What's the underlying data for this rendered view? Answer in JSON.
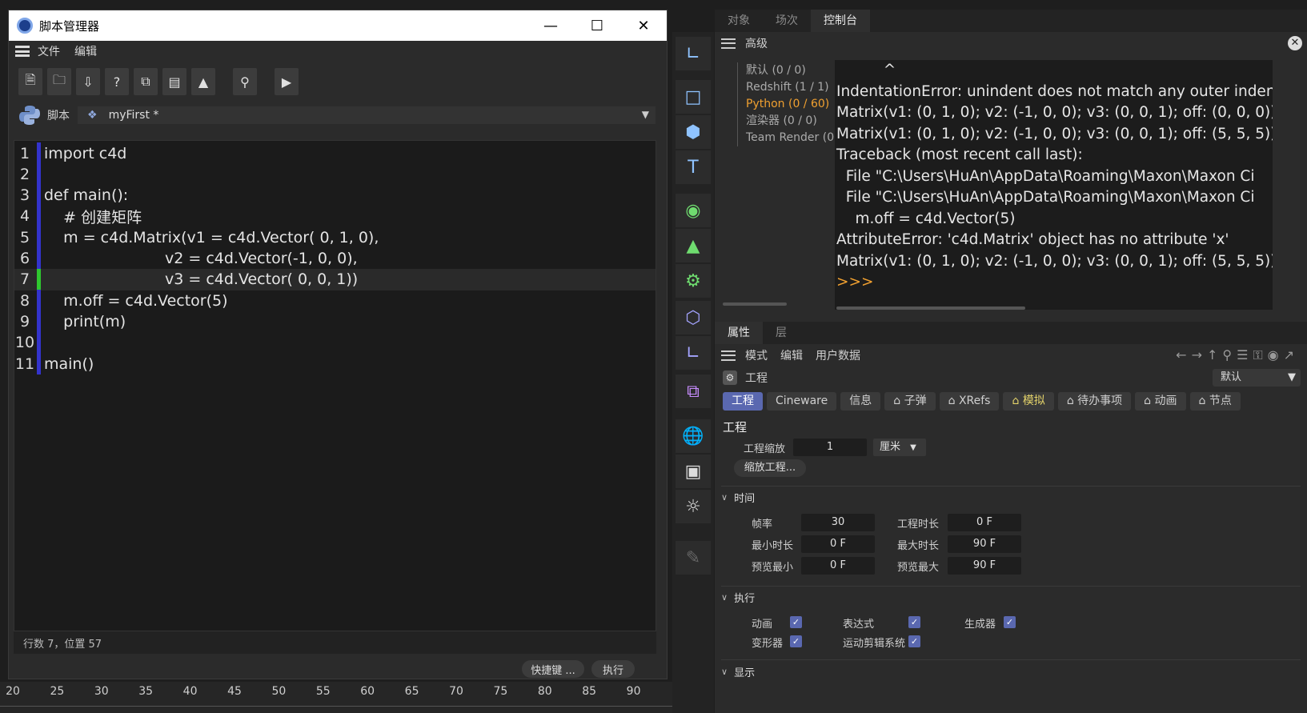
{
  "script_manager": {
    "title": "脚本管理器",
    "menu": [
      "文件",
      "编辑"
    ],
    "script_label": "脚本",
    "script_name": "myFirst *",
    "status": "行数 7，位置 57",
    "shortcut_button": "快捷键 ...",
    "run_button": "执行",
    "toolbar_icons": [
      "new-file-icon",
      "open-folder-icon",
      "download-icon",
      "help-icon",
      "duplicate-icon",
      "clapper-icon",
      "image-icon",
      "search-folder-icon",
      "play-file-icon"
    ],
    "code_lines": [
      {
        "n": "1",
        "html_kind": "import",
        "text": "import c4d"
      },
      {
        "n": "2",
        "text": ""
      },
      {
        "n": "3",
        "text": "def main():"
      },
      {
        "n": "4",
        "text": "    # 创建矩阵"
      },
      {
        "n": "5",
        "text": "    m = c4d.Matrix(v1 = c4d.Vector( 0, 1, 0),"
      },
      {
        "n": "6",
        "text": "                         v2 = c4d.Vector(-1, 0, 0),"
      },
      {
        "n": "7",
        "text": "                         v3 = c4d.Vector( 0, 0, 1))"
      },
      {
        "n": "8",
        "text": "    m.off = c4d.Vector(5)"
      },
      {
        "n": "9",
        "text": "    print(m)"
      },
      {
        "n": "10",
        "text": ""
      },
      {
        "n": "11",
        "text": "main()"
      }
    ]
  },
  "timeline": {
    "ticks": [
      "20",
      "25",
      "30",
      "35",
      "40",
      "45",
      "50",
      "55",
      "60",
      "65",
      "70",
      "75",
      "80",
      "85",
      "90"
    ]
  },
  "console": {
    "tabs": [
      "对象",
      "场次",
      "控制台"
    ],
    "header": "高级",
    "tree": [
      "默认 (0 / 0)",
      "Redshift (1 / 1)",
      "Python (0 / 60)",
      "渲染器 (0 / 0)",
      "Team Render  (0"
    ],
    "output": [
      "          ^",
      "IndentationError: unindent does not match any outer inden",
      "Matrix(v1: (0, 1, 0); v2: (-1, 0, 0); v3: (0, 0, 1); off: (0, 0, 0))",
      "Matrix(v1: (0, 1, 0); v2: (-1, 0, 0); v3: (0, 0, 1); off: (5, 5, 5))",
      "Traceback (most recent call last):",
      "  File \"C:\\Users\\HuAn\\AppData\\Roaming\\Maxon\\Maxon Ci",
      "  File \"C:\\Users\\HuAn\\AppData\\Roaming\\Maxon\\Maxon Ci",
      "    m.off = c4d.Vector(5)",
      "AttributeError: 'c4d.Matrix' object has no attribute 'x'",
      "Matrix(v1: (0, 1, 0); v2: (-1, 0, 0); v3: (0, 0, 1); off: (5, 5, 5))",
      ">>>"
    ]
  },
  "attributes": {
    "tabs": [
      "属性",
      "层"
    ],
    "menu": [
      "模式",
      "编辑",
      "用户数据"
    ],
    "object": "工程",
    "preset": "默认",
    "ptabs": [
      "工程",
      "Cineware",
      "信息",
      "子弹",
      "XRefs",
      "模拟",
      "待办事项",
      "动画",
      "节点"
    ],
    "section_title": "工程",
    "scale_label": "工程缩放",
    "scale_value": "1",
    "scale_unit": "厘米",
    "scale_button": "缩放工程...",
    "time_header": "时间",
    "fps_label": "帧率",
    "fps_value": "30",
    "proj_len_label": "工程时长",
    "proj_len_value": "0 F",
    "min_len_label": "最小时长",
    "min_len_value": "0 F",
    "max_len_label": "最大时长",
    "max_len_value": "90 F",
    "prev_min_label": "预览最小",
    "prev_min_value": "0 F",
    "prev_max_label": "预览最大",
    "prev_max_value": "90 F",
    "exec_header": "执行",
    "exec": [
      "动画",
      "表达式",
      "生成器",
      "变形器",
      "运动剪辑系统"
    ],
    "display_header": "显示"
  }
}
